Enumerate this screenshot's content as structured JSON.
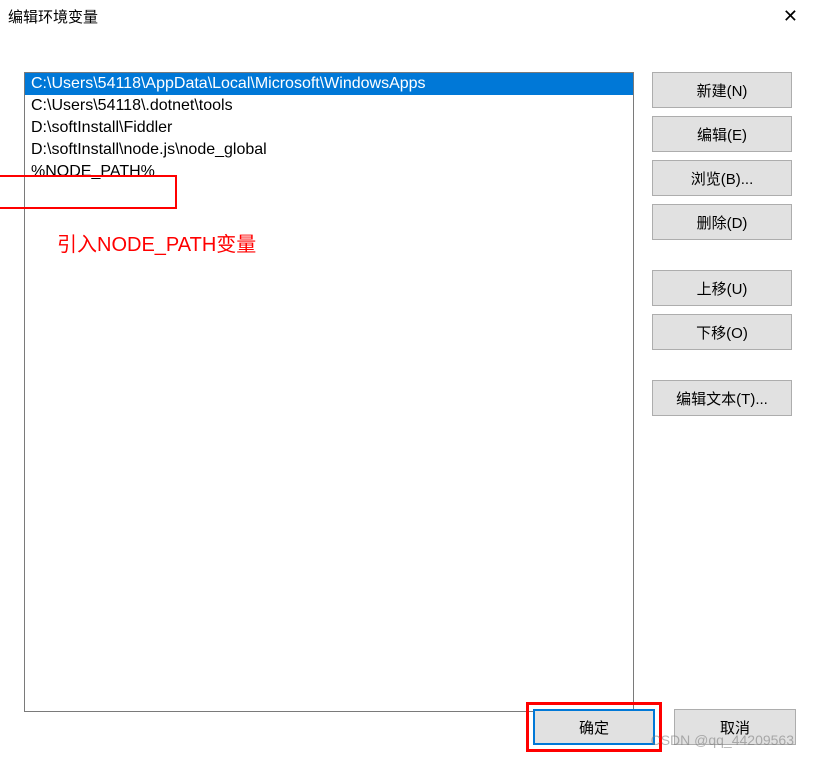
{
  "titlebar": {
    "title": "编辑环境变量",
    "close_icon": "✕"
  },
  "list": {
    "items": [
      {
        "text": "C:\\Users\\54118\\AppData\\Local\\Microsoft\\WindowsApps",
        "selected": true
      },
      {
        "text": "C:\\Users\\54118\\.dotnet\\tools",
        "selected": false
      },
      {
        "text": "D:\\softInstall\\Fiddler",
        "selected": false
      },
      {
        "text": "D:\\softInstall\\node.js\\node_global",
        "selected": false
      },
      {
        "text": "%NODE_PATH%",
        "selected": false
      }
    ]
  },
  "annotation": {
    "text": "引入NODE_PATH变量"
  },
  "buttons": {
    "new": "新建(N)",
    "edit": "编辑(E)",
    "browse": "浏览(B)...",
    "delete": "删除(D)",
    "move_up": "上移(U)",
    "move_down": "下移(O)",
    "edit_text": "编辑文本(T)...",
    "ok": "确定",
    "cancel": "取消"
  },
  "watermark": "CSDN @qq_44209563"
}
